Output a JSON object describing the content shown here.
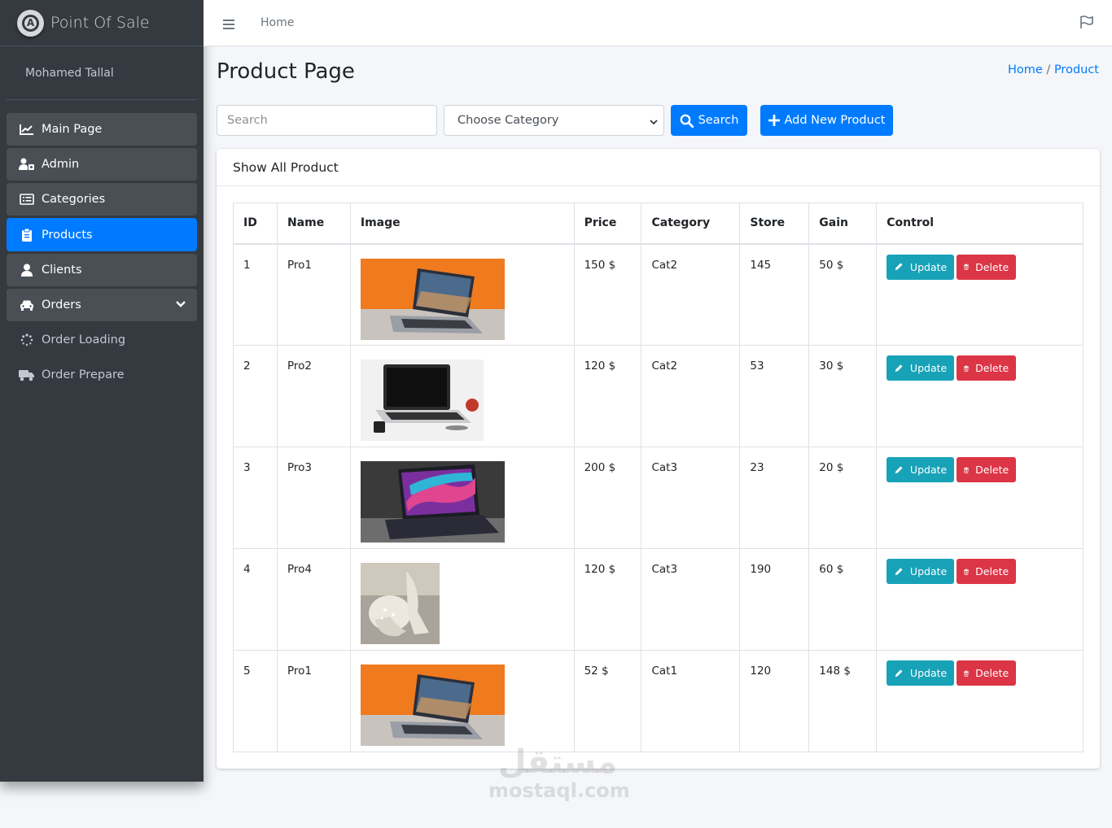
{
  "brand": {
    "name": "Point Of Sale",
    "logo_letter": "A"
  },
  "user": {
    "name": "Mohamed Tallal"
  },
  "sidebar": {
    "items": [
      {
        "label": "Main Page",
        "icon": "chart-line-icon"
      },
      {
        "label": "Admin",
        "icon": "users-cog-icon"
      },
      {
        "label": "Categories",
        "icon": "list-alt-icon"
      },
      {
        "label": "Products",
        "icon": "clipboard-icon",
        "active": true
      },
      {
        "label": "Clients",
        "icon": "user-icon"
      },
      {
        "label": "Orders",
        "icon": "car-icon",
        "expandable": true
      },
      {
        "label": "Order Loading",
        "icon": "spinner-icon"
      },
      {
        "label": "Order Prepare",
        "icon": "truck-icon"
      }
    ]
  },
  "topbar": {
    "home_link": "Home"
  },
  "page": {
    "title": "Product Page",
    "breadcrumb": {
      "home": "Home",
      "separator": "/",
      "current": "Product"
    }
  },
  "filters": {
    "search_placeholder": "Search",
    "category_select": "Choose Category",
    "search_button": "Search",
    "add_button": "Add New Product"
  },
  "card": {
    "title": "Show All Product"
  },
  "table": {
    "headers": [
      "ID",
      "Name",
      "Image",
      "Price",
      "Category",
      "Store",
      "Gain",
      "Control"
    ],
    "rows": [
      {
        "id": "1",
        "name": "Pro1",
        "image": "laptop-orange",
        "price": "150 $",
        "category": "Cat2",
        "store": "145",
        "gain": "50 $"
      },
      {
        "id": "2",
        "name": "Pro2",
        "image": "laptop-white",
        "price": "120 $",
        "category": "Cat2",
        "store": "53",
        "gain": "30 $"
      },
      {
        "id": "3",
        "name": "Pro3",
        "image": "laptop-colorful",
        "price": "200 $",
        "category": "Cat3",
        "store": "23",
        "gain": "20 $"
      },
      {
        "id": "4",
        "name": "Pro4",
        "image": "shoes",
        "price": "120 $",
        "category": "Cat3",
        "store": "190",
        "gain": "60 $"
      },
      {
        "id": "5",
        "name": "Pro1",
        "image": "laptop-orange",
        "price": "52 $",
        "category": "Cat1",
        "store": "120",
        "gain": "148 $"
      }
    ],
    "update_label": "Update",
    "delete_label": "Delete"
  },
  "watermark": {
    "arabic": "مستقل",
    "latin": "mostaql.com"
  },
  "colors": {
    "primary": "#007bff",
    "info": "#17a2b8",
    "danger": "#dc3545",
    "sidebar": "#343a40"
  }
}
